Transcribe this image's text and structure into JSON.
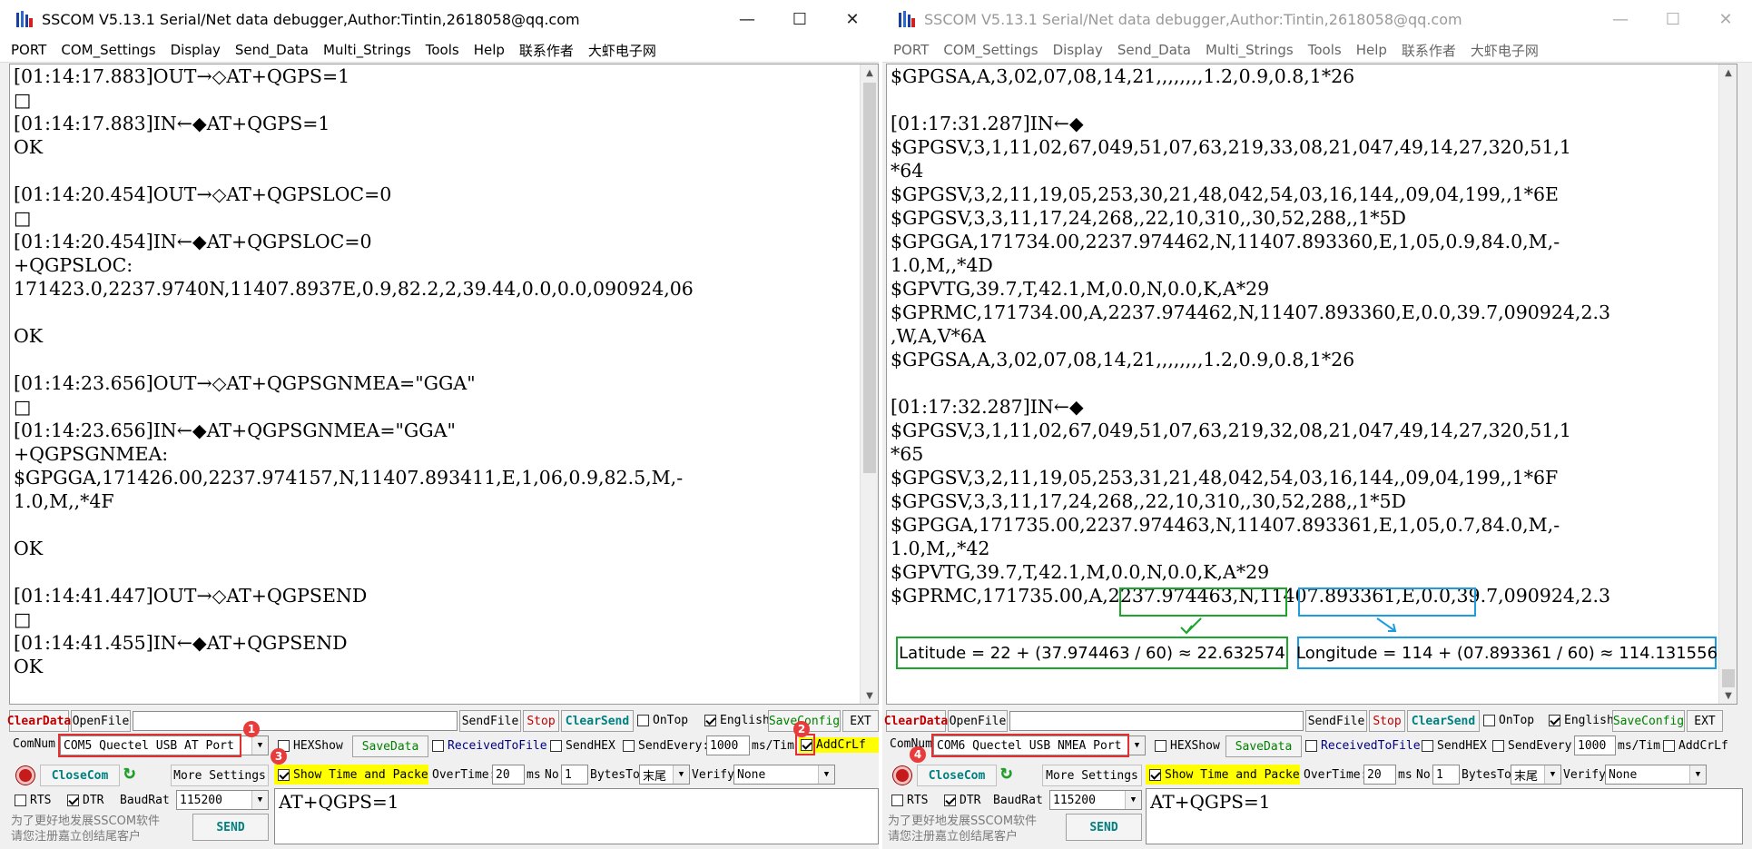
{
  "colors": {
    "annotation_green": "#1aa52b",
    "annotation_blue": "#1c9de0",
    "marker_red": "#e83b3b",
    "highlight_yellow": "#ffff00"
  },
  "window_controls": {
    "minimize": "—",
    "maximize": "☐",
    "close": "✕"
  },
  "menu": [
    "PORT",
    "COM_Settings",
    "Display",
    "Send_Data",
    "Multi_Strings",
    "Tools",
    "Help",
    "联系作者",
    "大虾电子网"
  ],
  "left": {
    "title": "SSCOM V5.13.1 Serial/Net data debugger,Author:Tintin,2618058@qq.com",
    "log": [
      "[01:14:17.883]OUT→◇AT+QGPS=1",
      "□",
      "[01:14:17.883]IN←◆AT+QGPS=1",
      "OK",
      "",
      "[01:14:20.454]OUT→◇AT+QGPSLOC=0",
      "□",
      "[01:14:20.454]IN←◆AT+QGPSLOC=0",
      "+QGPSLOC:",
      "171423.0,2237.9740N,11407.8937E,0.9,82.2,2,39.44,0.0,0.0,090924,06",
      "",
      "OK",
      "",
      "[01:14:23.656]OUT→◇AT+QGPSGNMEA=\"GGA\"",
      "□",
      "[01:14:23.656]IN←◆AT+QGPSGNMEA=\"GGA\"",
      "+QGPSGNMEA:",
      "$GPGGA,171426.00,2237.974157,N,11407.893411,E,1,06,0.9,82.5,M,-",
      "1.0,M,,*4F",
      "",
      "OK",
      "",
      "[01:14:41.447]OUT→◇AT+QGPSEND",
      "□",
      "[01:14:41.455]IN←◆AT+QGPSEND",
      "OK"
    ],
    "com_port": "COM5 Quectel USB AT Port",
    "input_text": "AT+QGPS=1",
    "markers": [
      "1",
      "2",
      "3"
    ]
  },
  "right": {
    "title": "SSCOM V5.13.1 Serial/Net data debugger,Author:Tintin,2618058@qq.com",
    "log": [
      "$GPGSA,A,3,02,07,08,14,21,,,,,,,,1.2,0.9,0.8,1*26",
      "",
      "[01:17:31.287]IN←◆",
      "$GPGSV,3,1,11,02,67,049,51,07,63,219,33,08,21,047,49,14,27,320,51,1",
      "*64",
      "$GPGSV,3,2,11,19,05,253,30,21,48,042,54,03,16,144,,09,04,199,,1*6E",
      "$GPGSV,3,3,11,17,24,268,,22,10,310,,30,52,288,,1*5D",
      "$GPGGA,171734.00,2237.974462,N,11407.893360,E,1,05,0.9,84.0,M,-",
      "1.0,M,,*4D",
      "$GPVTG,39.7,T,42.1,M,0.0,N,0.0,K,A*29",
      "$GPRMC,171734.00,A,2237.974462,N,11407.893360,E,0.0,39.7,090924,2.3",
      ",W,A,V*6A",
      "$GPGSA,A,3,02,07,08,14,21,,,,,,,,1.2,0.9,0.8,1*26",
      "",
      "[01:17:32.287]IN←◆",
      "$GPGSV,3,1,11,02,67,049,51,07,63,219,32,08,21,047,49,14,27,320,51,1",
      "*65",
      "$GPGSV,3,2,11,19,05,253,31,21,48,042,54,03,16,144,,09,04,199,,1*6F",
      "$GPGSV,3,3,11,17,24,268,,22,10,310,,30,52,288,,1*5D",
      "$GPGGA,171735.00,2237.974463,N,11407.893361,E,1,05,0.7,84.0,M,-",
      "1.0,M,,*42",
      "$GPVTG,39.7,T,42.1,M,0.0,N,0.0,K,A*29",
      "$GPRMC,171735.00,A,2237.974463,N,11407.893361,E,0.0,39.7,090924,2.3"
    ],
    "com_port": "COM6 Quectel USB NMEA Port",
    "input_text": "AT+QGPS=1",
    "markers": [
      "4"
    ],
    "annotations": {
      "latitude": "Latitude = 22 + (37.974463 / 60) ≈ 22.632574",
      "longitude": "Longitude = 114 + (07.893361 / 60) ≈ 114.131556"
    }
  },
  "controls": {
    "clear_data": "ClearData",
    "open_file": "OpenFile",
    "send_file": "SendFile",
    "stop": "Stop",
    "clear_send": "ClearSend",
    "on_top": "OnTop",
    "english": "English",
    "save_config": "SaveConfig",
    "ext": "EXT",
    "com_num": "ComNum",
    "hex_show": "HEXShow",
    "save_data": "SaveData",
    "received_to_file": "ReceivedToFile",
    "send_hex": "SendHEX",
    "send_every": "SendEvery:",
    "send_every_value": "1000",
    "ms_tim": "ms/Tim",
    "add_crlf": "AddCrLf",
    "close_com": "CloseCom",
    "more_settings": "More Settings",
    "show_time": "Show Time and Packe",
    "overtime": "OverTime:",
    "overtime_value": "20",
    "ms": "ms",
    "no": "No",
    "no_value": "1",
    "bytes_to": "BytesTo",
    "bytes_to_value": "末尾",
    "verify": "Verify",
    "verify_value": "None",
    "rts": "RTS",
    "dtr": "DTR",
    "baud_rate": "BaudRat",
    "baud_value": "115200",
    "send": "SEND",
    "promo_line1": "为了更好地发展SSCOM软件",
    "promo_line2": "请您注册嘉立创结尾客户"
  }
}
